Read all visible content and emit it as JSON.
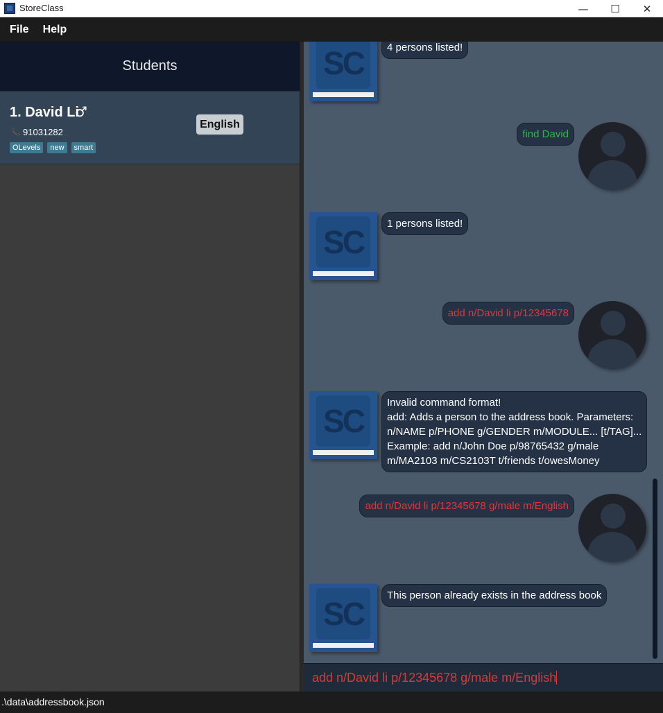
{
  "window": {
    "title": "StoreClass",
    "minimize": "—",
    "maximize": "☐",
    "close": "✕"
  },
  "menu": {
    "items": [
      "File",
      "Help"
    ]
  },
  "student_list": {
    "header": "Students",
    "students": [
      {
        "name": "1. David Li",
        "gender_symbol": "♂",
        "phone_icon": "phone-icon",
        "phone": "91031282",
        "tags": [
          "OLevels",
          "new",
          "smart"
        ],
        "module": "English"
      }
    ]
  },
  "chat": {
    "messages": [
      {
        "sender": "bot",
        "avatar_text": "SC",
        "text": "4 persons listed!"
      },
      {
        "sender": "user",
        "text": "find David",
        "status": "success"
      },
      {
        "sender": "bot",
        "avatar_text": "SC",
        "text": "1 persons listed!"
      },
      {
        "sender": "user",
        "text": "add n/David li p/12345678",
        "status": "error"
      },
      {
        "sender": "bot",
        "avatar_text": "SC",
        "text": "Invalid command format!\nadd: Adds a person to the address book. Parameters:\nn/NAME p/PHONE g/GENDER m/MODULE... [t/TAG]...\nExample: add n/John Doe p/98765432 g/male\nm/MA2103 m/CS2103T t/friends t/owesMoney"
      },
      {
        "sender": "user",
        "text": "add n/David li p/12345678 g/male m/English",
        "status": "error"
      },
      {
        "sender": "bot",
        "avatar_text": "SC",
        "text": "This person already exists in the address book"
      }
    ]
  },
  "command_box": {
    "value": "add n/David li p/12345678 g/male m/English"
  },
  "status_bar": {
    "path": ".\\data\\addressbook.json"
  },
  "colors": {
    "success_text": "#2fb54a",
    "error_text": "#e0363b",
    "bot_avatar": "#26548e",
    "tag_bg": "#3e7b91"
  }
}
